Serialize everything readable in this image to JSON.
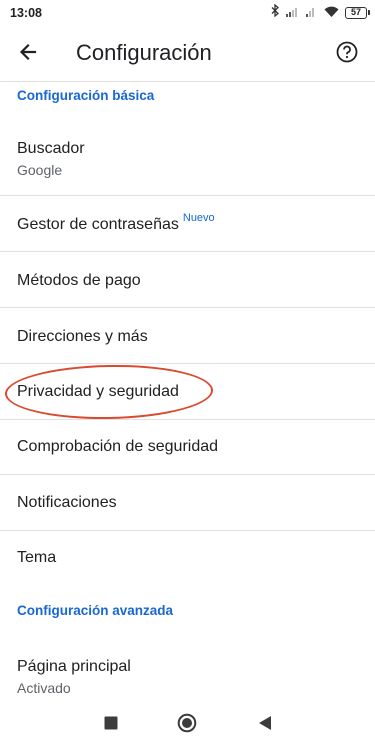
{
  "status_bar": {
    "time": "13:08",
    "battery": "57",
    "icons": [
      "bluetooth-icon",
      "signal-icon",
      "signal-icon-2",
      "wifi-icon",
      "battery-icon"
    ]
  },
  "app_bar": {
    "title": "Configuración",
    "back_icon": "arrow-left-icon",
    "help_icon": "help-circle-icon"
  },
  "sections": {
    "basic_header": "Configuración básica",
    "advanced_header": "Configuración avanzada"
  },
  "items": {
    "buscador": {
      "label": "Buscador",
      "value": "Google"
    },
    "passwords": {
      "label": "Gestor de contraseñas",
      "badge": "Nuevo"
    },
    "payment": {
      "label": "Métodos de pago"
    },
    "addresses": {
      "label": "Direcciones y más"
    },
    "privacy": {
      "label": "Privacidad y seguridad"
    },
    "safety_check": {
      "label": "Comprobación de seguridad"
    },
    "notifications": {
      "label": "Notificaciones"
    },
    "theme": {
      "label": "Tema"
    },
    "homepage": {
      "label": "Página principal",
      "value": "Activado"
    }
  },
  "colors": {
    "accent": "#1967d2",
    "annotation": "#d94a2e",
    "divider": "#e0e0e0",
    "secondary_text": "#5f6368"
  },
  "nav_bar": {
    "icons": [
      "recents-square-icon",
      "home-circle-icon",
      "back-triangle-icon"
    ]
  }
}
